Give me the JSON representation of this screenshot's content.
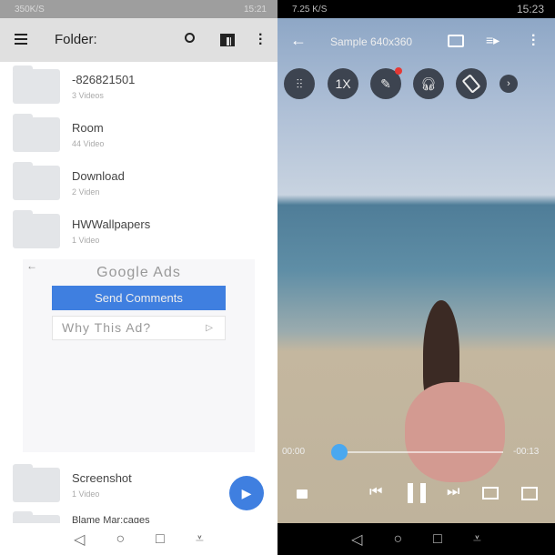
{
  "left": {
    "status": {
      "network": "350K/S",
      "time": "15:21"
    },
    "toolbar": {
      "title": "Folder:"
    },
    "folders": [
      {
        "name": "-826821501",
        "count": "3 Videos"
      },
      {
        "name": "Room",
        "count": "44 Video"
      },
      {
        "name": "Download",
        "count": "2 Viden"
      },
      {
        "name": "HWWallpapers",
        "count": "1 Video"
      },
      {
        "name": "Screenshot",
        "count": "1 Video"
      },
      {
        "name": "Blame Mar:cages",
        "count": ""
      }
    ],
    "ad": {
      "title": "Google Ads",
      "send_comments": "Send Comments",
      "why_this_ad": "Why This Ad?"
    }
  },
  "right": {
    "status": {
      "network": "7.25 K/S",
      "time": "15:23"
    },
    "title": "Sample 640x360",
    "speed": "1X",
    "time_elapsed": "00:00",
    "time_remaining": "-00:13",
    "progress": 0.03
  },
  "colors": {
    "accent": "#3f7fe0",
    "seek": "#4aa8f0",
    "badge": "#e53935"
  }
}
